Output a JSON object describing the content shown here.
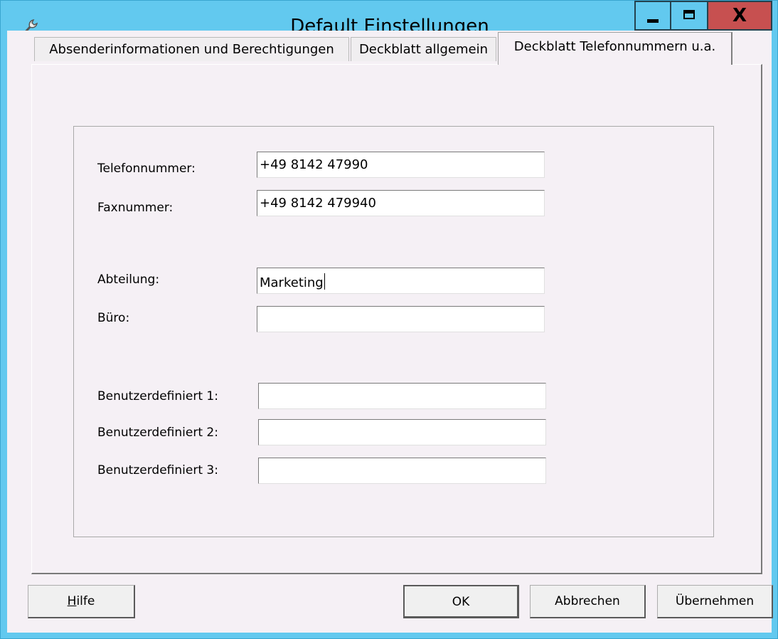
{
  "window": {
    "title": "Default Einstellungen",
    "icon": "wrench-icon",
    "controls": {
      "minimize": "minimize-icon",
      "maximize": "maximize-icon",
      "close": "X"
    }
  },
  "tabs": [
    {
      "label": "Absenderinformationen und Berechtigungen",
      "active": false
    },
    {
      "label": "Deckblatt allgemein",
      "active": false
    },
    {
      "label": "Deckblatt Telefonnummern u.a.",
      "active": true
    }
  ],
  "form": {
    "phone": {
      "label": "Telefonnummer:",
      "value": "+49 8142 47990"
    },
    "fax": {
      "label": "Faxnummer:",
      "value": "+49 8142 479940"
    },
    "department": {
      "label": "Abteilung:",
      "value": "Marketing"
    },
    "office": {
      "label": "Büro:",
      "value": ""
    },
    "custom1": {
      "label": "Benutzerdefiniert 1:",
      "value": ""
    },
    "custom2": {
      "label": "Benutzerdefiniert 2:",
      "value": ""
    },
    "custom3": {
      "label": "Benutzerdefiniert 3:",
      "value": ""
    }
  },
  "buttons": {
    "help_first": "H",
    "help_rest": "ilfe",
    "ok": "OK",
    "cancel": "Abbrechen",
    "apply": "Übernehmen"
  },
  "colors": {
    "titlebar": "#62c9ef",
    "close_button": "#c75050",
    "client_bg": "#f5f0f5"
  }
}
